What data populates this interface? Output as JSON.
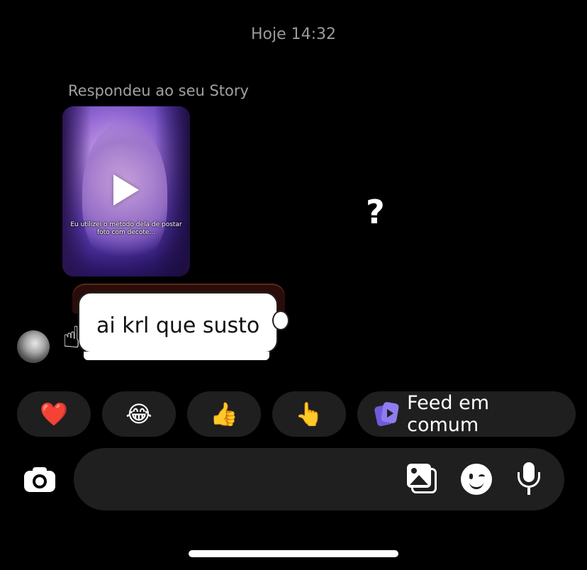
{
  "chat": {
    "timestamp": "Hoje 14:32",
    "story_reply_label": "Respondeu ao seu Story",
    "story_caption": "Eu utilizei o método dela de postar foto com decote...",
    "reaction_glyph": "?",
    "sticker_text": "ai krl que susto",
    "sticker_hand_glyph": "☝",
    "play_icon": "play-icon"
  },
  "quick_reactions": {
    "heart": "❤️",
    "tears_of_joy": "😂",
    "thumbs_up": "👍",
    "pointing_hand": "👆",
    "feed_label": "Feed em comum"
  },
  "composer": {
    "placeholder": "",
    "icons": [
      "camera-icon",
      "gallery-icon",
      "sticker-icon",
      "microphone-icon"
    ]
  },
  "colors": {
    "background": "#000000",
    "chip": "#1f1f1f",
    "feed_accent": "#8f7cf0",
    "muted_text": "#9a9a9a"
  }
}
